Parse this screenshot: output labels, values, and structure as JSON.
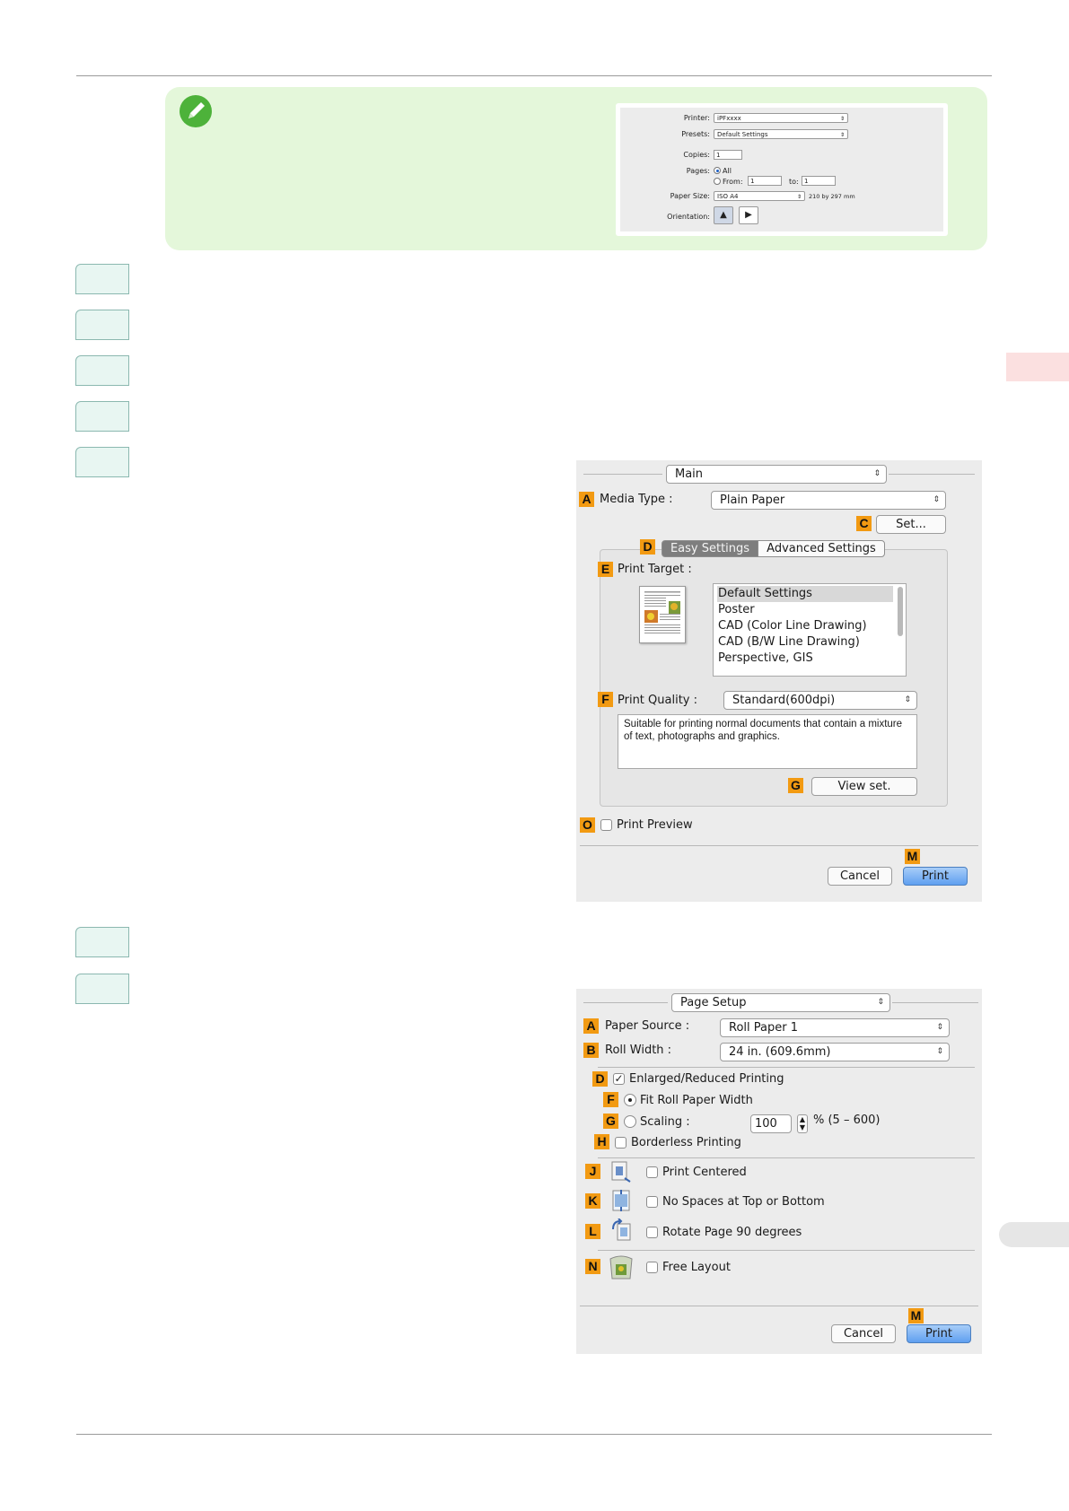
{
  "note_dialog": {
    "printer_label": "Printer:",
    "printer_value": "iPFxxxx",
    "presets_label": "Presets:",
    "presets_value": "Default Settings",
    "copies_label": "Copies:",
    "copies_value": "1",
    "pages_label": "Pages:",
    "pages_all": "All",
    "pages_from": "From:",
    "pages_from_value": "1",
    "pages_to": "to:",
    "pages_to_value": "1",
    "paper_size_label": "Paper Size:",
    "paper_size_value": "ISO A4",
    "paper_size_dims": "210 by 297 mm",
    "orientation_label": "Orientation:"
  },
  "main_dialog": {
    "panel_select": "Main",
    "media_type_label": "Media Type :",
    "media_type_value": "Plain Paper",
    "set_button": "Set...",
    "tab_easy": "Easy Settings",
    "tab_advanced": "Advanced Settings",
    "print_target_label": "Print Target :",
    "print_targets": [
      "Default Settings",
      "Poster",
      "CAD (Color Line Drawing)",
      "CAD (B/W Line Drawing)",
      "Perspective, GIS"
    ],
    "print_quality_label": "Print Quality :",
    "print_quality_value": "Standard(600dpi)",
    "quality_description": "Suitable for printing normal documents that contain a mixture of text, photographs and graphics.",
    "view_set_button": "View set.",
    "print_preview_label": "Print Preview",
    "cancel_button": "Cancel",
    "print_button": "Print",
    "tags": {
      "a": "A",
      "c": "C",
      "d": "D",
      "e": "E",
      "f": "F",
      "g": "G",
      "o": "O",
      "m": "M"
    }
  },
  "page_setup_dialog": {
    "panel_select": "Page Setup",
    "paper_source_label": "Paper Source :",
    "paper_source_value": "Roll Paper 1",
    "roll_width_label": "Roll Width :",
    "roll_width_value": "24 in. (609.6mm)",
    "enlarged_reduced_label": "Enlarged/Reduced Printing",
    "fit_roll_label": "Fit Roll Paper Width",
    "scaling_label": "Scaling :",
    "scaling_value": "100",
    "scaling_range": "% (5 – 600)",
    "borderless_label": "Borderless Printing",
    "print_centered_label": "Print Centered",
    "no_spaces_label": "No Spaces at Top or Bottom",
    "rotate_label": "Rotate Page 90 degrees",
    "free_layout_label": "Free Layout",
    "cancel_button": "Cancel",
    "print_button": "Print",
    "tags": {
      "a": "A",
      "b": "B",
      "d": "D",
      "f": "F",
      "g": "G",
      "h": "H",
      "j": "J",
      "k": "K",
      "l": "L",
      "n": "N",
      "m": "M"
    }
  },
  "colors": {
    "note_bg": "#e4f7da",
    "tag_orange": "#f29a12",
    "step_fill": "#e8f6f2",
    "side_tab_pink": "#fbe0e0"
  }
}
